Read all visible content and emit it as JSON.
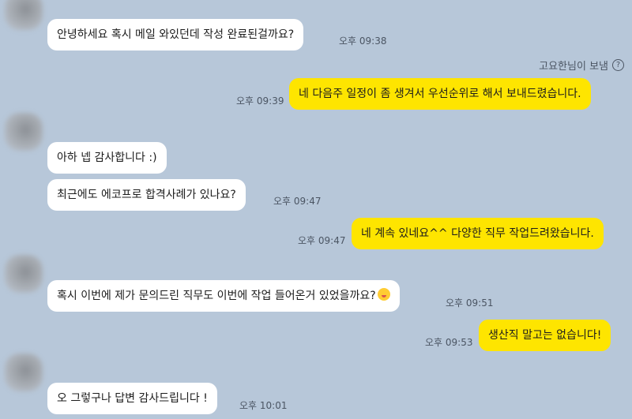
{
  "read_status": {
    "label": "고요한님이 보냄",
    "help_icon": "?"
  },
  "messages": [
    {
      "text": "안녕하세요 혹시 메일 와있던데 작성 완료된걸까요?",
      "time": "오후 09:38"
    },
    {
      "text": "네 다음주 일정이 좀 생겨서 우선순위로 해서 보내드렸습니다.",
      "time": "오후 09:39"
    },
    {
      "text": "아하 넵 감사합니다 :)",
      "time": ""
    },
    {
      "text": "최근에도 에코프로 합격사례가 있나요?",
      "time": "오후 09:47"
    },
    {
      "text": "네 계속 있네요^^ 다양한 직무 작업드려왔습니다.",
      "time": "오후 09:47"
    },
    {
      "text": "혹시 이번에 제가 문의드린 직무도 이번에 작업 들어온거 있었을까요?",
      "emoji": "smiling-face-emoji",
      "time": "오후 09:51"
    },
    {
      "text": "생산직 말고는 없습니다!",
      "time": "오후 09:53"
    },
    {
      "text": "오 그렇구나 답변 감사드립니다 !",
      "time": "오후 10:01"
    }
  ]
}
